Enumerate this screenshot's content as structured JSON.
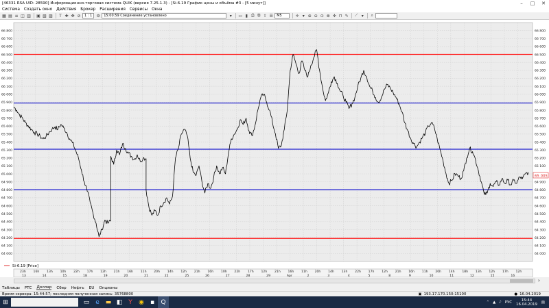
{
  "window": {
    "title": "[46331  RSA UID: 28590] Информационно-торговая система QUIK (версия 7.25.1.3) - [Si-6.19 График цены и объёма #3 - [5 минут]]",
    "minimize": "–",
    "maximize": "□",
    "close": "✕"
  },
  "menu": [
    "Система",
    "Создать окно",
    "Действия",
    "Брокер",
    "Расширения",
    "Сервисы",
    "Окна"
  ],
  "toolbar": {
    "ratio": "1 : 1",
    "status": "15:00:59  Соединение установлено",
    "interval": "M5",
    "search_placeholder": ""
  },
  "chart": {
    "legend": "Si-6.19 [Price]",
    "current_price": "65 005",
    "colors": {
      "red_level": "#ff2020",
      "blue_level": "#2020d0",
      "price_line": "#000000",
      "current_box": "#e03030"
    }
  },
  "chart_data": {
    "type": "line",
    "title": "",
    "series": [
      {
        "name": "Si-6.19 [Price]"
      }
    ],
    "ylim": [
      63900,
      66900
    ],
    "y_ticks": [
      "66 800",
      "66 700",
      "66 600",
      "66 500",
      "66 400",
      "66 300",
      "66 200",
      "66 100",
      "66 000",
      "65 900",
      "65 800",
      "65 700",
      "65 600",
      "65 500",
      "65 400",
      "65 300",
      "65 200",
      "65 100",
      "65 000",
      "64 900",
      "64 800",
      "64 700",
      "64 600",
      "64 500",
      "64 400",
      "64 300",
      "64 200",
      "64 100",
      "64 000"
    ],
    "horizontal_levels": [
      {
        "value": 66500,
        "color": "#ff2020"
      },
      {
        "value": 65890,
        "color": "#2020d0"
      },
      {
        "value": 65310,
        "color": "#2020d0"
      },
      {
        "value": 64800,
        "color": "#2020d0"
      },
      {
        "value": 64190,
        "color": "#ff2020"
      }
    ],
    "time_ticks": [
      "23h",
      "16h",
      "13h",
      "10h",
      "22h",
      "17h",
      "12h",
      "21h",
      "16h",
      "11h",
      "20h",
      "14h",
      "12h",
      "21h",
      "16h",
      "10h",
      "22h",
      "17h",
      "12h",
      "21h",
      "16h",
      "11h",
      "20h",
      "14h",
      "13h",
      "22h",
      "17h",
      "12h",
      "21h",
      "16h",
      "11h",
      "20h",
      "14h",
      "18h",
      "13h",
      "12h",
      "17h",
      "12h"
    ],
    "date_ticks": [
      "13",
      "14",
      "15",
      "18",
      "19",
      "20",
      "21",
      "22",
      "25",
      "26",
      "27",
      "28",
      "29",
      "Apr",
      "2",
      "3",
      "4",
      "5",
      "8",
      "9",
      "10",
      "11",
      "12",
      "15",
      "16"
    ],
    "points": [
      [
        0,
        65840
      ],
      [
        2,
        65800
      ],
      [
        4,
        65740
      ],
      [
        6,
        65700
      ],
      [
        8,
        65640
      ],
      [
        10,
        65600
      ],
      [
        12,
        65560
      ],
      [
        14,
        65520
      ],
      [
        16,
        65500
      ],
      [
        18,
        65470
      ],
      [
        20,
        65440
      ],
      [
        22,
        65470
      ],
      [
        24,
        65520
      ],
      [
        26,
        65560
      ],
      [
        28,
        65590
      ],
      [
        30,
        65560
      ],
      [
        32,
        65620
      ],
      [
        34,
        65580
      ],
      [
        36,
        65520
      ],
      [
        38,
        65440
      ],
      [
        40,
        65390
      ],
      [
        42,
        65300
      ],
      [
        44,
        65200
      ],
      [
        46,
        65050
      ],
      [
        48,
        64900
      ],
      [
        50,
        64780
      ],
      [
        52,
        64640
      ],
      [
        54,
        64500
      ],
      [
        56,
        64380
      ],
      [
        58,
        64210
      ],
      [
        60,
        64300
      ],
      [
        62,
        64420
      ],
      [
        64,
        64380
      ],
      [
        66,
        64410
      ],
      [
        66,
        65220
      ],
      [
        68,
        65120
      ],
      [
        70,
        65300
      ],
      [
        72,
        65240
      ],
      [
        74,
        65380
      ],
      [
        76,
        65320
      ],
      [
        78,
        65260
      ],
      [
        80,
        65220
      ],
      [
        82,
        65180
      ],
      [
        84,
        65240
      ],
      [
        86,
        65160
      ],
      [
        88,
        65200
      ],
      [
        90,
        65190
      ],
      [
        90,
        64800
      ],
      [
        92,
        64580
      ],
      [
        94,
        64480
      ],
      [
        96,
        64540
      ],
      [
        98,
        64480
      ],
      [
        100,
        64600
      ],
      [
        102,
        64640
      ],
      [
        104,
        64700
      ],
      [
        106,
        64620
      ],
      [
        108,
        64720
      ],
      [
        110,
        65200
      ],
      [
        112,
        65320
      ],
      [
        114,
        65500
      ],
      [
        116,
        65560
      ],
      [
        118,
        65480
      ],
      [
        120,
        65200
      ],
      [
        122,
        65020
      ],
      [
        124,
        64980
      ],
      [
        126,
        65100
      ],
      [
        128,
        64900
      ],
      [
        130,
        64760
      ],
      [
        132,
        64880
      ],
      [
        134,
        64820
      ],
      [
        136,
        64960
      ],
      [
        138,
        65100
      ],
      [
        140,
        65000
      ],
      [
        142,
        65080
      ],
      [
        144,
        65000
      ],
      [
        146,
        65260
      ],
      [
        148,
        65440
      ],
      [
        150,
        65500
      ],
      [
        152,
        65560
      ],
      [
        154,
        65680
      ],
      [
        156,
        65620
      ],
      [
        158,
        65700
      ],
      [
        160,
        65540
      ],
      [
        162,
        65480
      ],
      [
        164,
        65600
      ],
      [
        166,
        65800
      ],
      [
        168,
        65960
      ],
      [
        170,
        66000
      ],
      [
        172,
        65900
      ],
      [
        174,
        65800
      ],
      [
        176,
        65640
      ],
      [
        178,
        65500
      ],
      [
        180,
        65320
      ],
      [
        182,
        65360
      ],
      [
        184,
        65560
      ],
      [
        186,
        65800
      ],
      [
        188,
        66300
      ],
      [
        190,
        66500
      ],
      [
        192,
        66380
      ],
      [
        194,
        66260
      ],
      [
        196,
        66420
      ],
      [
        198,
        66300
      ],
      [
        200,
        66220
      ],
      [
        202,
        66360
      ],
      [
        204,
        66460
      ],
      [
        206,
        66560
      ],
      [
        208,
        66300
      ],
      [
        210,
        66080
      ],
      [
        212,
        65920
      ],
      [
        214,
        66020
      ],
      [
        216,
        66160
      ],
      [
        218,
        66220
      ],
      [
        220,
        66140
      ],
      [
        222,
        66040
      ],
      [
        224,
        65980
      ],
      [
        226,
        65900
      ],
      [
        228,
        65820
      ],
      [
        230,
        65880
      ],
      [
        232,
        65960
      ],
      [
        234,
        66100
      ],
      [
        236,
        66200
      ],
      [
        238,
        66300
      ],
      [
        240,
        66220
      ],
      [
        242,
        66100
      ],
      [
        244,
        66040
      ],
      [
        246,
        65960
      ],
      [
        248,
        65900
      ],
      [
        250,
        65960
      ],
      [
        252,
        66060
      ],
      [
        254,
        66120
      ],
      [
        256,
        66080
      ],
      [
        258,
        66020
      ],
      [
        260,
        65960
      ],
      [
        262,
        65880
      ],
      [
        264,
        65780
      ],
      [
        266,
        65640
      ],
      [
        268,
        65540
      ],
      [
        270,
        65440
      ],
      [
        272,
        65380
      ],
      [
        274,
        65340
      ],
      [
        276,
        65400
      ],
      [
        278,
        65460
      ],
      [
        280,
        65520
      ],
      [
        282,
        65600
      ],
      [
        284,
        65640
      ],
      [
        286,
        65580
      ],
      [
        288,
        65440
      ],
      [
        290,
        65300
      ],
      [
        292,
        65160
      ],
      [
        294,
        65000
      ],
      [
        296,
        64880
      ],
      [
        298,
        64920
      ],
      [
        300,
        65000
      ],
      [
        302,
        64980
      ],
      [
        304,
        64940
      ],
      [
        306,
        65040
      ],
      [
        308,
        65200
      ],
      [
        310,
        65320
      ],
      [
        312,
        65280
      ],
      [
        314,
        65180
      ],
      [
        316,
        65040
      ],
      [
        318,
        64900
      ],
      [
        320,
        64740
      ],
      [
        322,
        64760
      ],
      [
        324,
        64880
      ],
      [
        326,
        64840
      ],
      [
        328,
        64900
      ],
      [
        330,
        64860
      ],
      [
        332,
        64940
      ],
      [
        334,
        64880
      ],
      [
        336,
        64920
      ],
      [
        338,
        64860
      ],
      [
        340,
        64920
      ],
      [
        342,
        64880
      ],
      [
        344,
        64960
      ],
      [
        346,
        64940
      ],
      [
        348,
        65000
      ],
      [
        350,
        65020
      ]
    ]
  },
  "axis_tabs": [
    "Таблицы",
    "РТС",
    "Доллар",
    "Сбер",
    "Нефть",
    "EU",
    "Опционы"
  ],
  "statusbar": {
    "text": "Время сервера: 15:44:57; последняя полученная запись: 35768800",
    "ip": "193.17.170.150:15100",
    "date": "16.04.2019"
  },
  "taskbar": {
    "search_placeholder": "",
    "tray_lang": "РУС",
    "clock_time": "15:44",
    "clock_date": "16.04.2019"
  }
}
